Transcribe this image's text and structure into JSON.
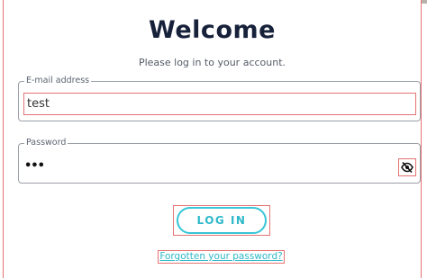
{
  "header": {
    "title": "Welcome",
    "subtitle": "Please log in to your account."
  },
  "email": {
    "label": "E-mail address",
    "value": "test"
  },
  "password": {
    "label": "Password",
    "masked_value": "•••",
    "toggle_icon": "eye-slash-icon"
  },
  "actions": {
    "login_label": "LOG IN",
    "forgot_label": "Forgotten your password?"
  },
  "colors": {
    "title": "#17213a",
    "accent": "#38c5d6",
    "highlight_outline": "#e57373"
  }
}
